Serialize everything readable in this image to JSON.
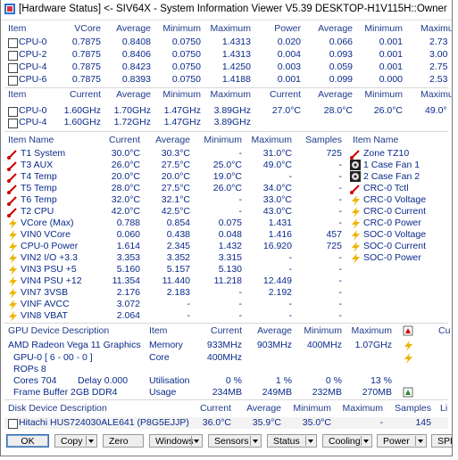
{
  "title": "[Hardware Status] <- SIV64X - System Information Viewer V5.39 DESKTOP-H1V115H::Owner",
  "cpu_volt": {
    "headers": [
      "Item",
      "VCore",
      "Average",
      "Minimum",
      "Maximum",
      "Power",
      "Average",
      "Minimum",
      "Maximum"
    ],
    "rows": [
      [
        "CPU-0",
        "0.7875",
        "0.8408",
        "0.0750",
        "1.4313",
        "0.020",
        "0.066",
        "0.001",
        "2.73"
      ],
      [
        "CPU-2",
        "0.7875",
        "0.8406",
        "0.0750",
        "1.4313",
        "0.004",
        "0.093",
        "0.001",
        "3.00"
      ],
      [
        "CPU-4",
        "0.7875",
        "0.8423",
        "0.0750",
        "1.4250",
        "0.003",
        "0.059",
        "0.001",
        "2.75"
      ],
      [
        "CPU-6",
        "0.7875",
        "0.8393",
        "0.0750",
        "1.4188",
        "0.001",
        "0.099",
        "0.000",
        "2.53"
      ]
    ]
  },
  "cpu_clock": {
    "headers": [
      "Item",
      "Current",
      "Average",
      "Minimum",
      "Maximum",
      "Current",
      "Average",
      "Minimum",
      "Maximum"
    ],
    "rows": [
      [
        "CPU-0",
        "1.60GHz",
        "1.70GHz",
        "1.47GHz",
        "3.89GHz",
        "27.0°C",
        "28.0°C",
        "26.0°C",
        "49.0°"
      ],
      [
        "CPU-4",
        "1.60GHz",
        "1.72GHz",
        "1.47GHz",
        "3.89GHz",
        "",
        "",
        "",
        ""
      ]
    ]
  },
  "sensors": {
    "headers": [
      "Item Name",
      "Current",
      "Average",
      "Minimum",
      "Maximum",
      "Samples",
      "Item Name"
    ],
    "temps": [
      [
        "T1 System",
        "30.0°C",
        "30.3°C",
        "-",
        "31.0°C",
        "725"
      ],
      [
        "T3 AUX",
        "26.0°C",
        "27.5°C",
        "25.0°C",
        "49.0°C",
        "-"
      ],
      [
        "T4 Temp",
        "20.0°C",
        "20.0°C",
        "19.0°C",
        "-",
        "-"
      ],
      [
        "T5 Temp",
        "28.0°C",
        "27.5°C",
        "26.0°C",
        "34.0°C",
        "-"
      ],
      [
        "T6 Temp",
        "32.0°C",
        "32.1°C",
        "-",
        "33.0°C",
        "-"
      ],
      [
        "T2 CPU",
        "42.0°C",
        "42.5°C",
        "-",
        "43.0°C",
        "-"
      ]
    ],
    "volts": [
      [
        "VCore (Max)",
        "0.788",
        "0.854",
        "0.075",
        "1.431",
        "-"
      ],
      [
        "VIN0 VCore",
        "0.060",
        "0.438",
        "0.048",
        "1.416",
        "457"
      ],
      [
        "CPU-0 Power",
        "1.614",
        "2.345",
        "1.432",
        "16.920",
        "725"
      ],
      [
        "VIN2 I/O +3.3",
        "3.353",
        "3.352",
        "3.315",
        "-",
        "-"
      ],
      [
        "VIN3 PSU +5",
        "5.160",
        "5.157",
        "5.130",
        "-",
        "-"
      ],
      [
        "VIN4 PSU +12",
        "11.354",
        "11.440",
        "11.218",
        "12.449",
        "-"
      ],
      [
        "VIN7 3VSB",
        "2.176",
        "2.183",
        "-",
        "2.192",
        "-"
      ],
      [
        "VINF AVCC",
        "3.072",
        "-",
        "-",
        "-",
        "-"
      ],
      [
        "VIN8 VBAT",
        "2.064",
        "-",
        "-",
        "-",
        "-"
      ]
    ],
    "right_items": [
      "Zone TZ10",
      "1 Case Fan 1",
      "2 Case Fan 2",
      "CRC-0 Tctl",
      "CRC-0 Voltage",
      "CRC-0 Current",
      "CRC-0 Power",
      "SOC-0 Voltage",
      "SOC-0 Current",
      "SOC-0 Power"
    ]
  },
  "gpu": {
    "headers": [
      "GPU Device Description",
      "Item",
      "Current",
      "Average",
      "Minimum",
      "Maximum",
      "Cu"
    ],
    "device": "AMD Radeon Vega 11 Graphics",
    "gpu_line": "GPU-0 [ 6 - 00 - 0 ]",
    "rops": "ROPs 8",
    "cores": "Cores 704",
    "delay": "Delay 0.000",
    "framebuffer": "Frame Buffer 2GB DDR4",
    "rows": [
      [
        "Memory",
        "933MHz",
        "903MHz",
        "400MHz",
        "1.07GHz"
      ],
      [
        "Core",
        "400MHz",
        "",
        "",
        ""
      ],
      [
        "Utilisation",
        "0 %",
        "1 %",
        "0 %",
        "13 %"
      ],
      [
        "Usage",
        "234MB",
        "249MB",
        "232MB",
        "270MB"
      ]
    ]
  },
  "disk": {
    "headers": [
      "Disk Device Description",
      "Current",
      "Average",
      "Minimum",
      "Maximum",
      "Samples",
      "Li"
    ],
    "row": [
      "Hitachi HUS724030ALE641 (P8G5EJJP)",
      "36.0°C",
      "35.9°C",
      "35.0°C",
      "-",
      "145"
    ]
  },
  "buttons": [
    "OK",
    "Copy",
    "Zero",
    "Windows",
    "Sensors",
    "Status",
    "Cooling",
    "Power",
    "SPD"
  ]
}
